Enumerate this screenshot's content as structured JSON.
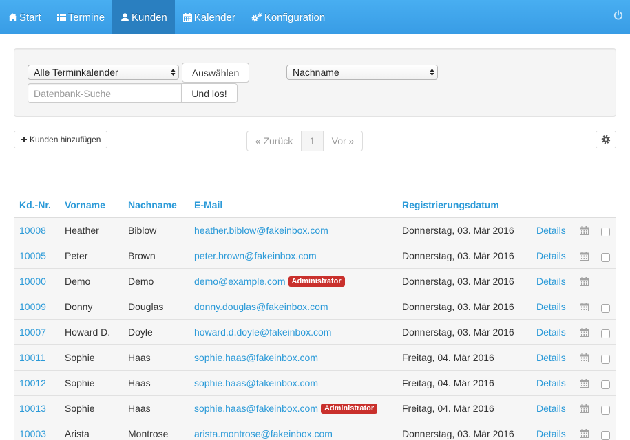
{
  "navbar": {
    "items": [
      {
        "label": "Start",
        "icon": "home-icon",
        "active": false
      },
      {
        "label": "Termine",
        "icon": "list-icon",
        "active": false
      },
      {
        "label": "Kunden",
        "icon": "user-icon",
        "active": true
      },
      {
        "label": "Kalender",
        "icon": "calendar-icon",
        "active": false
      },
      {
        "label": "Konfiguration",
        "icon": "cogs-icon",
        "active": false
      }
    ],
    "logout_icon": "power-icon"
  },
  "filters": {
    "calendar_select": "Alle Terminkalender",
    "select_button": "Auswählen",
    "sort_select": "Nachname",
    "search_placeholder": "Datenbank-Suche",
    "search_value": "",
    "search_button": "Und los!"
  },
  "toolbar": {
    "add_customer_label": "Kunden hinzufügen",
    "add_icon": "plus-icon",
    "settings_icon": "gear-icon"
  },
  "pagination": {
    "prev_label": "« Zurück",
    "current_page": "1",
    "next_label": "Vor »",
    "prev_disabled": true,
    "next_disabled": true
  },
  "table": {
    "columns": {
      "id": "Kd.-Nr.",
      "first_name": "Vorname",
      "last_name": "Nachname",
      "email": "E-Mail",
      "registered": "Registrierungsdatum"
    },
    "rows": [
      {
        "id": "10008",
        "first_name": "Heather",
        "last_name": "Biblow",
        "email": "heather.biblow@fakeinbox.com",
        "badge": null,
        "registered": "Donnerstag, 03. Mär 2016",
        "details": "Details",
        "appointments_icon": "calendar-icon",
        "selectable": true,
        "selected": false
      },
      {
        "id": "10005",
        "first_name": "Peter",
        "last_name": "Brown",
        "email": "peter.brown@fakeinbox.com",
        "badge": null,
        "registered": "Donnerstag, 03. Mär 2016",
        "details": "Details",
        "appointments_icon": "calendar-icon",
        "selectable": true,
        "selected": false
      },
      {
        "id": "10000",
        "first_name": "Demo",
        "last_name": "Demo",
        "email": "demo@example.com",
        "badge": "Administrator",
        "registered": "Donnerstag, 03. Mär 2016",
        "details": "Details",
        "appointments_icon": "calendar-icon",
        "selectable": false,
        "selected": false
      },
      {
        "id": "10009",
        "first_name": "Donny",
        "last_name": "Douglas",
        "email": "donny.douglas@fakeinbox.com",
        "badge": null,
        "registered": "Donnerstag, 03. Mär 2016",
        "details": "Details",
        "appointments_icon": "calendar-icon",
        "selectable": true,
        "selected": false
      },
      {
        "id": "10007",
        "first_name": "Howard D.",
        "last_name": "Doyle",
        "email": "howard.d.doyle@fakeinbox.com",
        "badge": null,
        "registered": "Donnerstag, 03. Mär 2016",
        "details": "Details",
        "appointments_icon": "calendar-icon",
        "selectable": true,
        "selected": false
      },
      {
        "id": "10011",
        "first_name": "Sophie",
        "last_name": "Haas",
        "email": "sophie.haas@fakeinbox.com",
        "badge": null,
        "registered": "Freitag, 04. Mär 2016",
        "details": "Details",
        "appointments_icon": "calendar-icon",
        "selectable": true,
        "selected": false
      },
      {
        "id": "10012",
        "first_name": "Sophie",
        "last_name": "Haas",
        "email": "sophie.haas@fakeinbox.com",
        "badge": null,
        "registered": "Freitag, 04. Mär 2016",
        "details": "Details",
        "appointments_icon": "calendar-icon",
        "selectable": true,
        "selected": false
      },
      {
        "id": "10013",
        "first_name": "Sophie",
        "last_name": "Haas",
        "email": "sophie.haas@fakeinbox.com",
        "badge": "Administrator",
        "registered": "Freitag, 04. Mär 2016",
        "details": "Details",
        "appointments_icon": "calendar-icon",
        "selectable": true,
        "selected": false
      },
      {
        "id": "10003",
        "first_name": "Arista",
        "last_name": "Montrose",
        "email": "arista.montrose@fakeinbox.com",
        "badge": null,
        "registered": "Donnerstag, 03. Mär 2016",
        "details": "Details",
        "appointments_icon": "calendar-icon",
        "selectable": true,
        "selected": false
      }
    ]
  },
  "colors": {
    "navbar_top": "#48aef1",
    "navbar_bottom": "#389ce5",
    "navbar_active": "#2a7fc0",
    "link": "#2b9ad8",
    "admin_badge": "#c9302c"
  }
}
